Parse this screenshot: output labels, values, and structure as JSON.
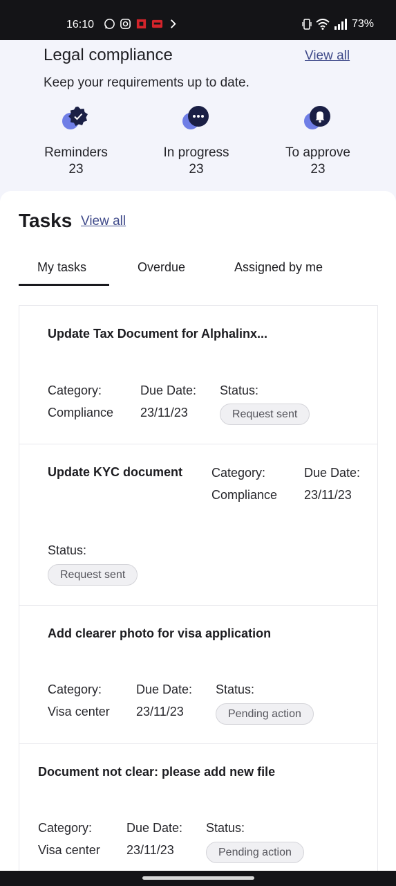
{
  "statusbar": {
    "time": "16:10",
    "app_icons": [
      "whatsapp-icon",
      "instagram-icon",
      "app-icon",
      "app-icon",
      "app-icon"
    ],
    "battery": "73%"
  },
  "compliance": {
    "title": "Legal compliance",
    "view_all": "View all",
    "subtitle": "Keep your requirements up to date.",
    "stats": [
      {
        "label": "Reminders",
        "count": "23",
        "icon": "verified-badge-icon"
      },
      {
        "label": "In progress",
        "count": "23",
        "icon": "more-dots-icon"
      },
      {
        "label": "To approve",
        "count": "23",
        "icon": "bell-icon"
      }
    ]
  },
  "tasks": {
    "title": "Tasks",
    "view_all": "View all",
    "tabs": [
      "My tasks",
      "Overdue",
      "Assigned by me"
    ],
    "category_label": "Category:",
    "due_label": "Due Date:",
    "status_label": "Status:",
    "items": [
      {
        "name": "Update Tax Document for Alphalinx...",
        "category": "Compliance",
        "due": "23/11/23",
        "status": "Request sent"
      },
      {
        "name": "Update KYC document",
        "category": "Compliance",
        "due": "23/11/23",
        "status": "Request sent"
      },
      {
        "name": "Add clearer photo for visa application",
        "category": "Visa center",
        "due": "23/11/23",
        "status": "Pending action"
      },
      {
        "name": "Document not clear: please add new file",
        "category": "Visa center",
        "due": "23/11/23",
        "status": "Pending action"
      }
    ]
  },
  "colors": {
    "accent_link": "#3f4a8a",
    "icon_dark": "#1a1f45",
    "icon_light": "#6f7ee6"
  }
}
